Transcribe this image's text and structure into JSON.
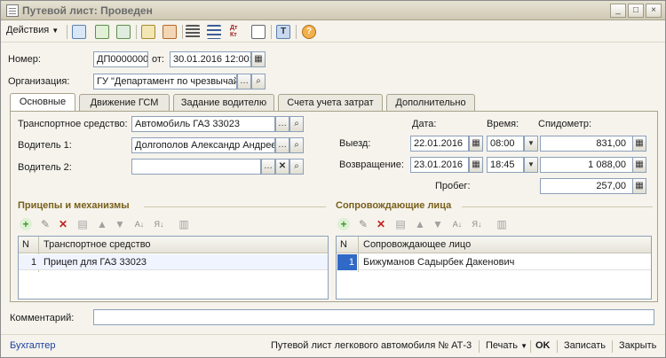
{
  "window": {
    "title": "Путевой лист: Проведен",
    "controls": [
      "_",
      "□",
      "×"
    ]
  },
  "toolbar": {
    "actions_label": "Действия",
    "debit_credit_label": "Дт Кт",
    "icons": [
      "copy-icon",
      "refresh-icon",
      "add-icon",
      "post-icon",
      "unpost-icon",
      "list-icon",
      "structure-icon",
      "debit-credit-icon",
      "doc-icon",
      "text-mode-icon",
      "help-icon"
    ]
  },
  "header": {
    "number_label": "Номер:",
    "number_value": "ДП0000000",
    "from_label": "от:",
    "date_value": "30.01.2016 12:00:",
    "org_label": "Организация:",
    "org_value": "ГУ \"Департамент по чрезвычай"
  },
  "tabs": [
    {
      "label": "Основные",
      "active": true
    },
    {
      "label": "Движение ГСМ",
      "active": false
    },
    {
      "label": "Задание водителю",
      "active": false
    },
    {
      "label": "Счета учета затрат",
      "active": false
    },
    {
      "label": "Дополнительно",
      "active": false
    }
  ],
  "main": {
    "vehicle_label": "Транспортное средство:",
    "vehicle_value": "Автомобиль ГАЗ 33023",
    "driver1_label": "Водитель 1:",
    "driver1_value": "Долгополов Александр Андрее",
    "driver2_label": "Водитель 2:",
    "driver2_value": "",
    "col_date": "Дата:",
    "col_time": "Время:",
    "col_speedo": "Спидометр:",
    "departure_label": "Выезд:",
    "departure_date": "22.01.2016",
    "departure_time": "08:00",
    "departure_speedo": "831,00",
    "return_label": "Возвращение:",
    "return_date": "23.01.2016",
    "return_time": "18:45",
    "return_speedo": "1 088,00",
    "mileage_label": "Пробег:",
    "mileage_value": "257,00"
  },
  "trailers": {
    "title": "Прицепы и механизмы",
    "col_n": "N",
    "col_name": "Транспортное средство",
    "rows": [
      {
        "n": "1",
        "name": "Прицеп для ГАЗ 33023"
      }
    ]
  },
  "escorts": {
    "title": "Сопровождающие лица",
    "col_n": "N",
    "col_name": "Сопровождающее лицо",
    "rows": [
      {
        "n": "1",
        "name": "Бижуманов Садырбек Дакенович"
      }
    ]
  },
  "comment": {
    "label": "Комментарий:",
    "value": ""
  },
  "statusbar": {
    "left_link": "Бухгалтер",
    "print_form": "Путевой лист легкового автомобиля № АТ-3",
    "print_label": "Печать",
    "ok_label": "OK",
    "save_label": "Записать",
    "close_label": "Закрыть"
  },
  "colors": {
    "section_title": "#7a5f1a",
    "field_border": "#8ca0b8",
    "selection": "#3169c6"
  }
}
